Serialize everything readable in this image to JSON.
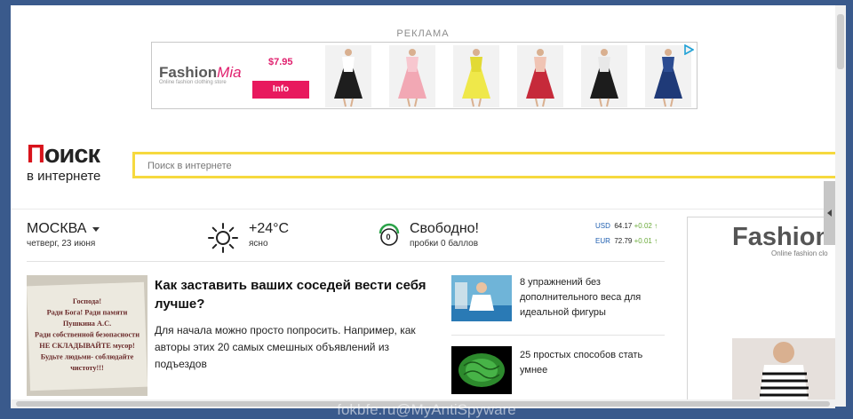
{
  "ad": {
    "label": "РЕКЛАМА",
    "brand_main": "Fashion",
    "brand_accent": "Mia",
    "tagline": "Online fashion clothing store",
    "price": "$7.95",
    "button_label": "Info",
    "dresses": [
      {
        "color": "#1e1e1e",
        "accent": "#ffffff"
      },
      {
        "color": "#f2a8b4",
        "accent": "#f7c7cf"
      },
      {
        "color": "#efe84a",
        "accent": "#e2da34"
      },
      {
        "color": "#c62a3a",
        "accent": "#f0c4b4"
      },
      {
        "color": "#1c1c1c",
        "accent": "#e8e8e8"
      },
      {
        "color": "#1f3a78",
        "accent": "#2c4c92"
      }
    ]
  },
  "header": {
    "logo_first_letter": "П",
    "logo_rest": "оиск",
    "logo_subtitle": "в интернете",
    "search_placeholder": "Поиск в интернете"
  },
  "info": {
    "city": "МОСКВА",
    "date": "четверг, 23 июня",
    "temperature": "+24°C",
    "condition": "ясно",
    "traffic_level": "0",
    "traffic_status": "Свободно!",
    "traffic_score": "пробки 0 баллов",
    "currencies": [
      {
        "code": "USD",
        "value": "64.17",
        "change": "+0.02"
      },
      {
        "code": "EUR",
        "value": "72.79",
        "change": "+0.01"
      }
    ]
  },
  "news": {
    "main_title": "Как заставить ваших соседей вести себя лучше?",
    "main_text": "Для начала можно просто попросить. Например, как авторы этих 20 самых смешных объявлений из подъездов",
    "main_image_text": "Господа!\nРади Бога! Ради памяти\nПушкина А.С.\nРади собственной безопасности\nНЕ СКЛАДЫВАЙТЕ мусор!\nБудьте людьми- соблюдайте\nчистоту!!!",
    "side": [
      {
        "title": "8 упражнений без дополнительного веса для идеальной фигуры"
      },
      {
        "title": "25 простых способов стать умнее"
      }
    ]
  },
  "right_ad": {
    "brand": "Fashion",
    "tagline": "Online fashion clo"
  },
  "watermark": "fokbfe.ru@MyAntiSpyware"
}
